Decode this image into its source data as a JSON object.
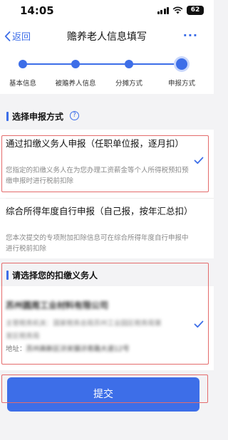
{
  "status_bar": {
    "time": "14:05",
    "battery": "62",
    "icons": [
      "signal-icon",
      "wifi-icon",
      "battery-icon"
    ]
  },
  "nav": {
    "back_label": "返回",
    "title": "赡养老人信息填写",
    "more_label": "···"
  },
  "steps": [
    {
      "label": "基本信息",
      "state": "done"
    },
    {
      "label": "被赡养人信息",
      "state": "done"
    },
    {
      "label": "分摊方式",
      "state": "done"
    },
    {
      "label": "申报方式",
      "state": "current"
    }
  ],
  "declare_section": {
    "title": "选择申报方式",
    "help_icon": "?",
    "options": [
      {
        "title": "通过扣缴义务人申报（任职单位报，逐月扣）",
        "description": "您指定的扣缴义务人在为您办理工资薪金等个人所得税预扣预缴申报时进行税前扣除",
        "selected": true
      },
      {
        "title": "综合所得年度自行申报（自己报，按年汇总扣）",
        "description": "您本次提交的专项附加扣除信息可在综合所得年度自行申报中进行税前扣除",
        "selected": false
      }
    ]
  },
  "agent_section": {
    "title": "请选择您的扣缴义务人",
    "agent": {
      "name": "苏州圆周工业材料有限公司",
      "line1": "主管税务机关：国家税务总局苏州工业园区税务局第",
      "line2": "发区税务局",
      "address_label": "地址：",
      "address_value": "苏州高新区浒关镇浒青路大道12号",
      "selected": true
    }
  },
  "submit": {
    "label": "提交"
  },
  "colors": {
    "accent": "#3d6ee8",
    "annotation_red": "#e46b6b",
    "background": "#f3f3f5"
  }
}
